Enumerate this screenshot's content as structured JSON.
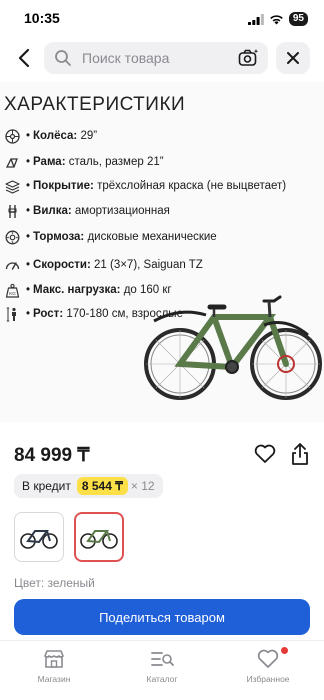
{
  "status_bar": {
    "time": "10:35",
    "battery": "95"
  },
  "header": {
    "search_placeholder": "Поиск товара"
  },
  "specs": {
    "title": "ХАРАКТЕРИСТИКИ",
    "items": [
      {
        "icon": "wheel-icon",
        "label": "Колёса:",
        "value": "29”"
      },
      {
        "icon": "frame-icon",
        "label": "Рама:",
        "value": "сталь, размер 21”"
      },
      {
        "icon": "layers-icon",
        "label": "Покрытие:",
        "value": "трёхслойная краска (не выцветает)"
      },
      {
        "icon": "fork-icon",
        "label": "Вилка:",
        "value": "амортизационная"
      },
      {
        "icon": "brake-disc-icon",
        "label": "Тормоза:",
        "value": "дисковые механические"
      },
      {
        "icon": "speedometer-icon",
        "label": "Скорости:",
        "value": "21 (3×7), Saiguan TZ"
      },
      {
        "icon": "weight-icon",
        "label": "Макс. нагрузка:",
        "value": "до 160 кг"
      },
      {
        "icon": "person-height-icon",
        "label": "Рост:",
        "value": "170-180 см, взрослые"
      }
    ]
  },
  "product": {
    "price": "84 999 ₸",
    "credit_label": "В кредит",
    "credit_amount": "8 544 ₸",
    "credit_months": "× 12",
    "color_label": "Цвет: зеленый",
    "share_button": "Поделиться товаром",
    "bike_color": "#5a7a4a",
    "thumbnail_selected_index": 1
  },
  "bottom_nav": {
    "items": [
      {
        "icon": "store-icon",
        "label": "Магазин"
      },
      {
        "icon": "catalog-icon",
        "label": "Каталог"
      },
      {
        "icon": "heart-icon",
        "label": "Избранное"
      }
    ]
  }
}
